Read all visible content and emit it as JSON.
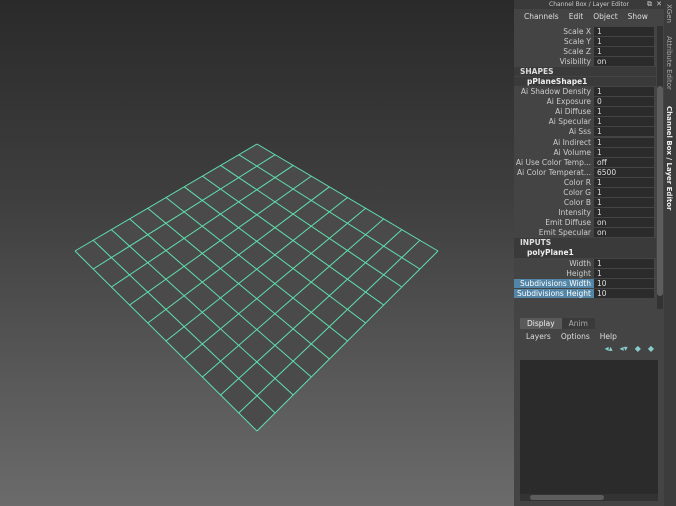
{
  "viewport": {
    "subdivisions_width": 10,
    "subdivisions_height": 10,
    "wire_color": "#5fe0b0",
    "face_color": "#4a4a4a"
  },
  "panel": {
    "title": "Channel Box / Layer Editor",
    "menu": [
      "Channels",
      "Edit",
      "Object",
      "Show"
    ],
    "rows": [
      {
        "type": "attr",
        "label": "Scale X",
        "value": "1"
      },
      {
        "type": "attr",
        "label": "Scale Y",
        "value": "1"
      },
      {
        "type": "attr",
        "label": "Scale Z",
        "value": "1"
      },
      {
        "type": "attr",
        "label": "Visibility",
        "value": "on"
      },
      {
        "type": "section",
        "label": "SHAPES"
      },
      {
        "type": "node",
        "label": "pPlaneShape1"
      },
      {
        "type": "attr",
        "label": "Ai Shadow Density",
        "value": "1"
      },
      {
        "type": "attr",
        "label": "Ai Exposure",
        "value": "0"
      },
      {
        "type": "attr",
        "label": "Ai Diffuse",
        "value": "1"
      },
      {
        "type": "attr",
        "label": "Ai Specular",
        "value": "1"
      },
      {
        "type": "attr",
        "label": "Ai Sss",
        "value": "1"
      },
      {
        "type": "attr",
        "label": "Ai Indirect",
        "value": "1"
      },
      {
        "type": "attr",
        "label": "Ai Volume",
        "value": "1"
      },
      {
        "type": "attr",
        "label": "Ai Use Color Temp...",
        "value": "off"
      },
      {
        "type": "attr",
        "label": "Ai Color Temperat...",
        "value": "6500"
      },
      {
        "type": "attr",
        "label": "Color R",
        "value": "1"
      },
      {
        "type": "attr",
        "label": "Color G",
        "value": "1"
      },
      {
        "type": "attr",
        "label": "Color B",
        "value": "1"
      },
      {
        "type": "attr",
        "label": "Intensity",
        "value": "1"
      },
      {
        "type": "attr",
        "label": "Emit Diffuse",
        "value": "on"
      },
      {
        "type": "attr",
        "label": "Emit Specular",
        "value": "on"
      },
      {
        "type": "section",
        "label": "INPUTS"
      },
      {
        "type": "node",
        "label": "polyPlane1"
      },
      {
        "type": "attr",
        "label": "Width",
        "value": "1"
      },
      {
        "type": "attr",
        "label": "Height",
        "value": "1"
      },
      {
        "type": "attr",
        "label": "Subdivisions Width",
        "value": "10",
        "selected": true
      },
      {
        "type": "attr",
        "label": "Subdivisions Height",
        "value": "10",
        "selected": true
      }
    ],
    "layer_tabs": [
      "Display",
      "Anim"
    ],
    "layer_menu": [
      "Layers",
      "Options",
      "Help"
    ]
  },
  "side_tabs": [
    "XGen",
    "Attribute Editor",
    "Channel Box / Layer Editor"
  ]
}
